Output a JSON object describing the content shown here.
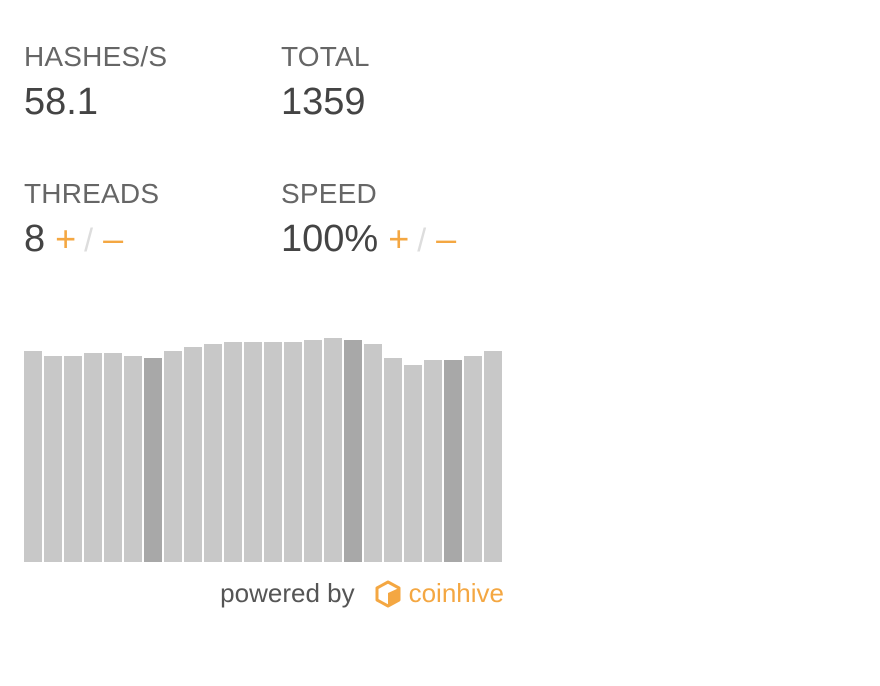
{
  "stats": {
    "hashes_label": "HASHES/S",
    "hashes_value": "58.1",
    "total_label": "TOTAL",
    "total_value": "1359",
    "threads_label": "THREADS",
    "threads_value": "8",
    "speed_label": "SPEED",
    "speed_value": "100%"
  },
  "controls": {
    "plus": "+",
    "slash": "/",
    "minus": "–"
  },
  "graph": {
    "description_values_relative_percent": [
      94,
      92,
      92,
      93,
      93,
      92,
      91,
      94,
      96,
      97,
      98,
      98,
      98,
      98,
      99,
      100,
      99,
      97,
      91,
      88,
      90,
      90,
      92,
      94
    ],
    "highlighted_bars": [
      6,
      16,
      21
    ],
    "bar_color": "#c8c8c8",
    "highlight_color": "#a8a8a8"
  },
  "footer": {
    "powered_by": "powered by",
    "brand": "coinhive",
    "brand_icon": "cube-icon",
    "brand_color": "#f4a742"
  }
}
